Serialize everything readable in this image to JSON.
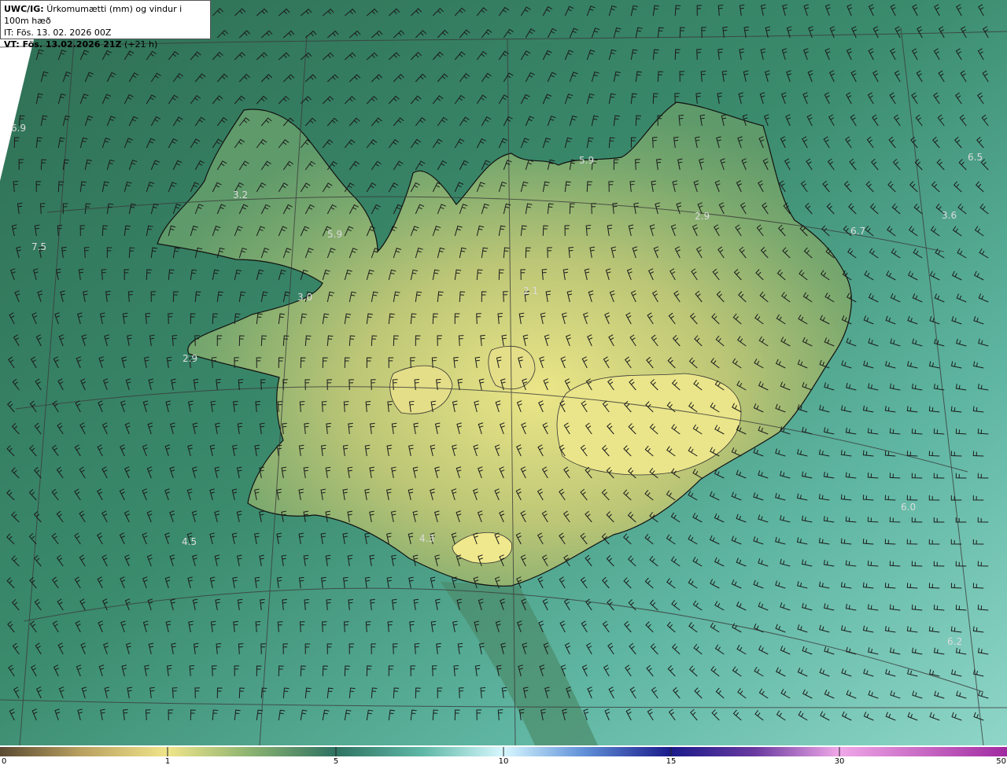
{
  "header": {
    "model": "UWC/IG:",
    "variable": "Úrkomumætti (mm) og vindur i 100m hæð",
    "init_time": "IT: Fös. 13. 02. 2026 00Z",
    "valid_label": "VT: Fös. 13.02.2026 21Z",
    "lead_time": "(+21 h)"
  },
  "map": {
    "colors": {
      "ocean_dark": "#2e6a52",
      "ocean_light": "#6cc1b0",
      "land_low": "#5e9a6c",
      "land_high": "#e8e48a",
      "coast": "#111111",
      "grid": "#3a3a3a",
      "label": "#dddddd"
    },
    "value_labels": [
      {
        "text": "6.9"
      },
      {
        "text": "3.2"
      },
      {
        "text": "5.9"
      },
      {
        "text": "7.5"
      },
      {
        "text": "3.0"
      },
      {
        "text": "2.9"
      },
      {
        "text": "5.9"
      },
      {
        "text": "2.9"
      },
      {
        "text": "6.5"
      },
      {
        "text": "6.7"
      },
      {
        "text": "3.6"
      },
      {
        "text": "2.1"
      },
      {
        "text": "6.0"
      },
      {
        "text": "4.5"
      },
      {
        "text": "4.3"
      },
      {
        "text": "6.2"
      }
    ]
  },
  "colorbar": {
    "ticks": [
      "0",
      "1",
      "5",
      "10",
      "15",
      "30",
      "50"
    ],
    "colors": [
      "#5a4a32",
      "#b8a060",
      "#f0e58a",
      "#5f9c6a",
      "#2f7262",
      "#5fb8a6",
      "#a6e8e0",
      "#d8f8ff",
      "#6090d8",
      "#1a1a8a",
      "#4a2a90",
      "#b060c0",
      "#f0a8e8",
      "#a02aa0"
    ]
  }
}
